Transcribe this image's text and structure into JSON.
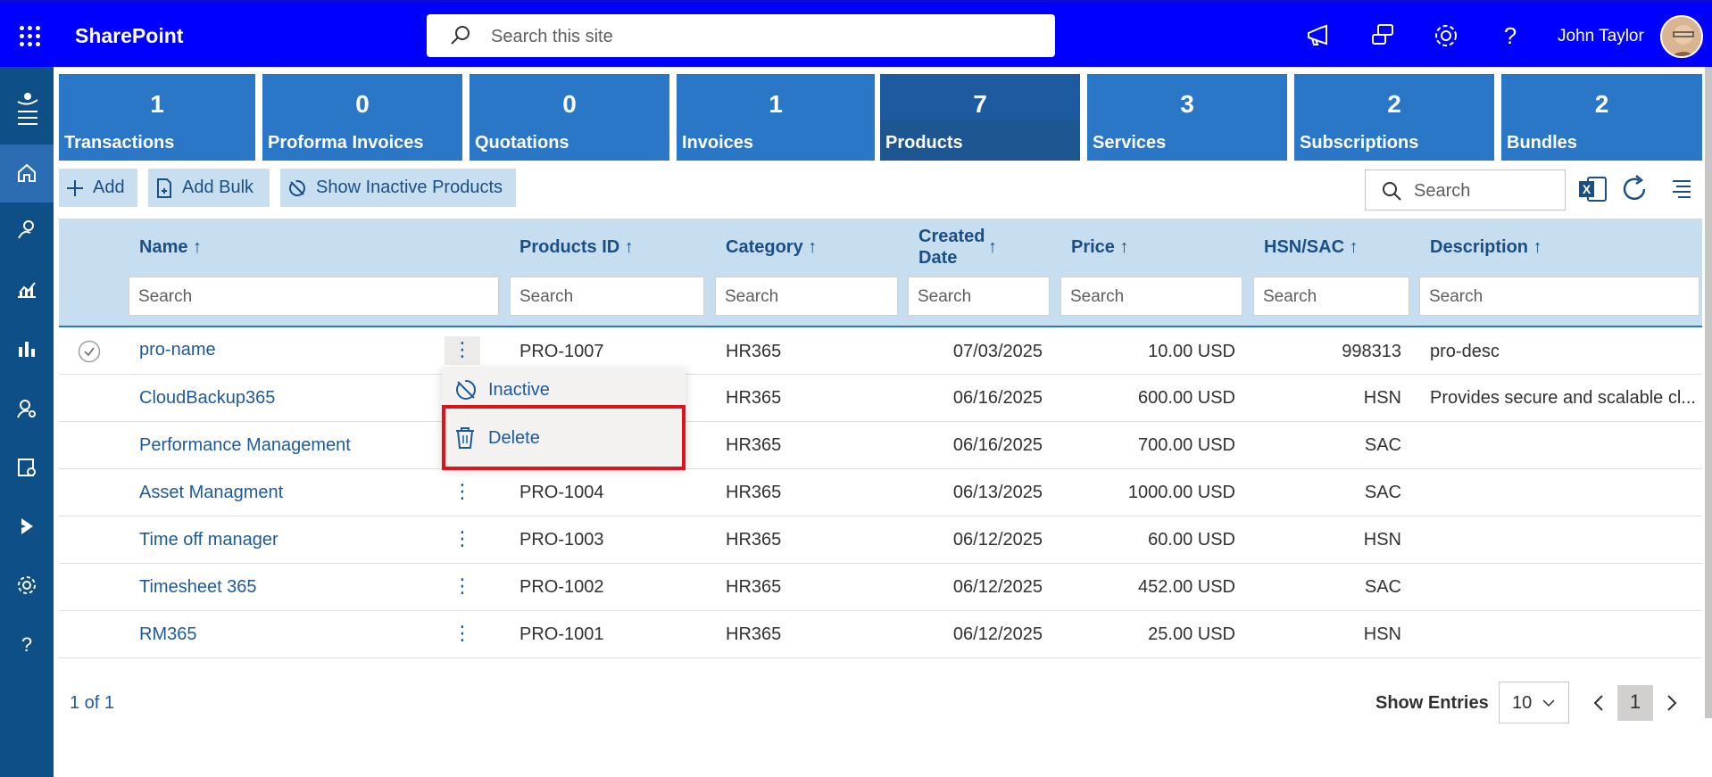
{
  "header": {
    "app_name": "SharePoint",
    "search_placeholder": "Search this site",
    "user_name": "John Taylor"
  },
  "tiles": [
    {
      "count": "1",
      "label": "Transactions"
    },
    {
      "count": "0",
      "label": "Proforma Invoices"
    },
    {
      "count": "0",
      "label": "Quotations"
    },
    {
      "count": "1",
      "label": "Invoices"
    },
    {
      "count": "7",
      "label": "Products"
    },
    {
      "count": "3",
      "label": "Services"
    },
    {
      "count": "2",
      "label": "Subscriptions"
    },
    {
      "count": "2",
      "label": "Bundles"
    }
  ],
  "toolbar": {
    "add_label": "Add",
    "add_bulk_label": "Add Bulk",
    "show_inactive_label": "Show Inactive Products",
    "search_placeholder": "Search"
  },
  "table": {
    "columns": {
      "name": "Name ↑",
      "product_id": "Products ID ↑",
      "category": "Category ↑",
      "created_line1": "Created",
      "created_line2": "Date",
      "created_arrow": "↑",
      "price": "Price ↑",
      "hsn": "HSN/SAC ↑",
      "description": "Description ↑"
    },
    "filter_placeholder": "Search",
    "rows": [
      {
        "name": "pro-name",
        "id": "PRO-1007",
        "category": "HR365",
        "date": "07/03/2025",
        "price": "10.00 USD",
        "hsn": "998313",
        "desc": "pro-desc"
      },
      {
        "name": "CloudBackup365",
        "id": "",
        "category": "HR365",
        "date": "06/16/2025",
        "price": "600.00 USD",
        "hsn": "HSN",
        "desc": "Provides secure and scalable cl..."
      },
      {
        "name": "Performance Management",
        "id": "",
        "category": "HR365",
        "date": "06/16/2025",
        "price": "700.00 USD",
        "hsn": "SAC",
        "desc": ""
      },
      {
        "name": "Asset Managment",
        "id": "PRO-1004",
        "category": "HR365",
        "date": "06/13/2025",
        "price": "1000.00 USD",
        "hsn": "SAC",
        "desc": ""
      },
      {
        "name": "Time off manager",
        "id": "PRO-1003",
        "category": "HR365",
        "date": "06/12/2025",
        "price": "60.00 USD",
        "hsn": "HSN",
        "desc": ""
      },
      {
        "name": "Timesheet 365",
        "id": "PRO-1002",
        "category": "HR365",
        "date": "06/12/2025",
        "price": "452.00 USD",
        "hsn": "SAC",
        "desc": ""
      },
      {
        "name": "RM365",
        "id": "PRO-1001",
        "category": "HR365",
        "date": "06/12/2025",
        "price": "25.00 USD",
        "hsn": "HSN",
        "desc": ""
      }
    ]
  },
  "context_menu": {
    "inactive_label": "Inactive",
    "delete_label": "Delete"
  },
  "footer": {
    "page_count": "1 of 1",
    "show_entries_label": "Show Entries",
    "entries_value": "10",
    "current_page": "1"
  },
  "colors": {
    "topbar": "#0000ff",
    "rail": "#0f4f88",
    "tile": "#2b77c7",
    "highlight_box": "#e0131b"
  }
}
